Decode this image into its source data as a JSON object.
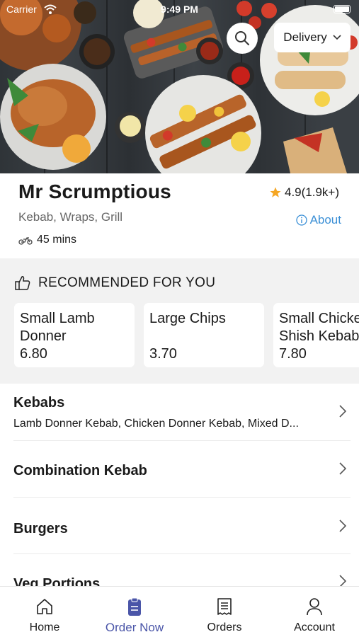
{
  "status_bar": {
    "carrier": "Carrier",
    "time": "9:49 PM"
  },
  "header": {
    "delivery_mode": "Delivery"
  },
  "store": {
    "name": "Mr Scrumptious",
    "rating": "4.9(1.9k+)",
    "cuisines": "Kebab, Wraps, Grill",
    "about_label": "About",
    "eta": "45 mins"
  },
  "recommended": {
    "title": "RECOMMENDED FOR YOU",
    "items": [
      {
        "name": "Small Lamb\nDonner",
        "price": "6.80"
      },
      {
        "name": "Large Chips",
        "price": "3.70"
      },
      {
        "name": "Small Chicken\nShish Kebab",
        "price": "7.80"
      }
    ]
  },
  "categories": [
    {
      "title": "Kebabs",
      "subtitle": "Lamb Donner Kebab, Chicken Donner Kebab, Mixed D..."
    },
    {
      "title": "Combination Kebab"
    },
    {
      "title": "Burgers"
    },
    {
      "title": "Veg Portions"
    }
  ],
  "tabs": [
    {
      "label": "Home",
      "icon": "home-icon",
      "active": false
    },
    {
      "label": "Order Now",
      "icon": "order-clipboard-icon",
      "active": true
    },
    {
      "label": "Orders",
      "icon": "receipt-icon",
      "active": false
    },
    {
      "label": "Account",
      "icon": "person-icon",
      "active": false
    }
  ],
  "colors": {
    "accent": "#4a55a8",
    "link": "#3a8fd6",
    "star": "#f5a623",
    "section_bg": "#f2f2f2"
  }
}
